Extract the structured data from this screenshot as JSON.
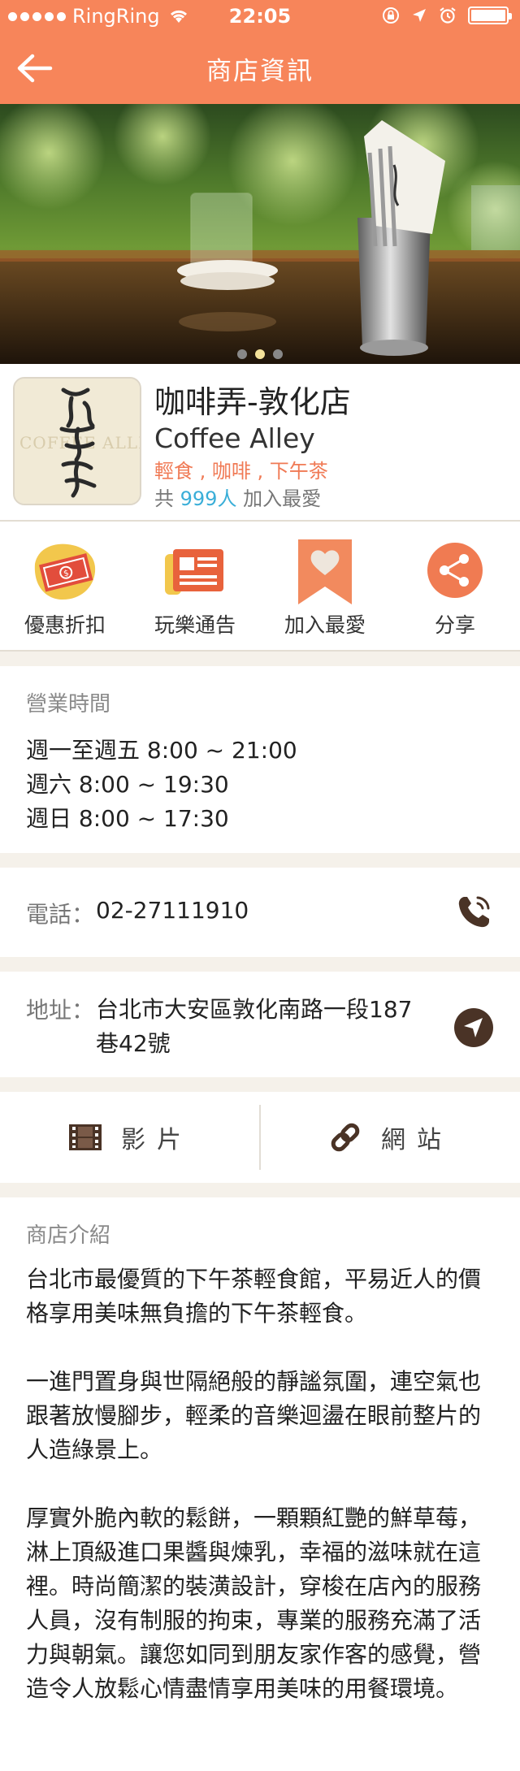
{
  "status_bar": {
    "carrier": "RingRing",
    "time": "22:05"
  },
  "nav": {
    "title": "商店資訊"
  },
  "hero": {
    "page_count": 3,
    "active_page": 2
  },
  "store": {
    "name": "咖啡弄-敦化店",
    "english_name": "Coffee Alley",
    "categories": "輕食 , 咖啡 , 下午茶",
    "favorites_prefix": "共",
    "favorites_count": "999人",
    "favorites_suffix": "加入最愛",
    "logo_text": "COFFEE ALLEY"
  },
  "actions": [
    {
      "label": "優惠折扣",
      "icon": "coupon-icon"
    },
    {
      "label": "玩樂通告",
      "icon": "news-icon"
    },
    {
      "label": "加入最愛",
      "icon": "heart-bookmark-icon"
    },
    {
      "label": "分享",
      "icon": "share-icon"
    }
  ],
  "hours": {
    "title": "營業時間",
    "lines": [
      "週一至週五 8:00 ~ 21:00",
      "週六 8:00 ~ 19:30",
      "週日 8:00 ~ 17:30"
    ]
  },
  "phone": {
    "label": "電話：",
    "value": "02-27111910"
  },
  "address": {
    "label": "地址：",
    "value": "台北市大安區敦化南路一段187巷42號"
  },
  "links": {
    "video": "影片",
    "website": "網站"
  },
  "intro": {
    "title": "商店介紹",
    "paragraphs": [
      "台北市最優質的下午茶輕食館，平易近人的價格享用美味無負擔的下午茶輕食。",
      "一進門置身與世隔絕般的靜謐氛圍，連空氣也跟著放慢腳步，輕柔的音樂迴盪在眼前整片的人造綠景上。",
      "厚實外脆內軟的鬆餅，一顆顆紅艷的鮮草莓，淋上頂級進口果醬與煉乳，幸福的滋味就在這裡。時尚簡潔的裝潢設計，穿梭在店內的服務人員，沒有制服的拘束，專業的服務充滿了活力與朝氣。讓您如同到朋友家作客的感覺，營造令人放鬆心情盡情享用美味的用餐環境。"
    ]
  },
  "colors": {
    "header": "#f7855a",
    "accent_orange": "#f07a55",
    "count_blue": "#3aaed8"
  }
}
